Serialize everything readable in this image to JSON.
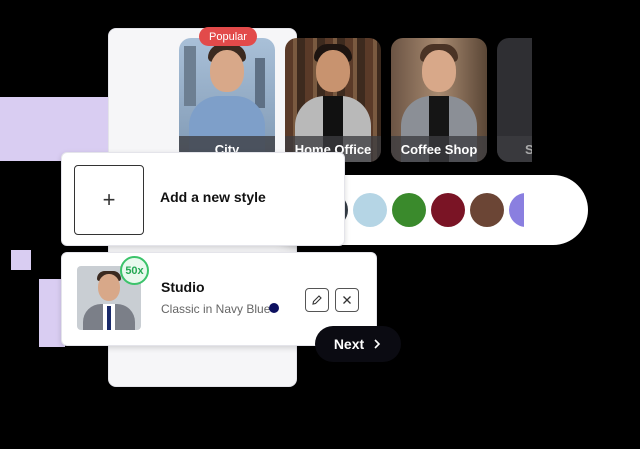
{
  "styles": [
    {
      "label": "City",
      "bg": "#8fa8c3",
      "body": "#7e9fc9"
    },
    {
      "label": "Home Office",
      "bg": "#6a4a35",
      "body": "#b9b9b9"
    },
    {
      "label": "Coffee Shop",
      "bg": "#8b6d58",
      "body": "#8b8f96"
    },
    {
      "label": "S",
      "bg": "#3c3c40",
      "body": "#555"
    }
  ],
  "popular_badge": "Popular",
  "add_style": {
    "icon": "+",
    "label": "Add a new style"
  },
  "colors": [
    "#343c45",
    "#b5d5e5",
    "#3a8a2c",
    "#7a1425",
    "#6b4535",
    "#8a7fe0"
  ],
  "studio": {
    "title": "Studio",
    "subtitle": "Classic in Navy Blue",
    "count_badge": "50x",
    "dot_color": "#0d1060"
  },
  "next_label": "Next"
}
